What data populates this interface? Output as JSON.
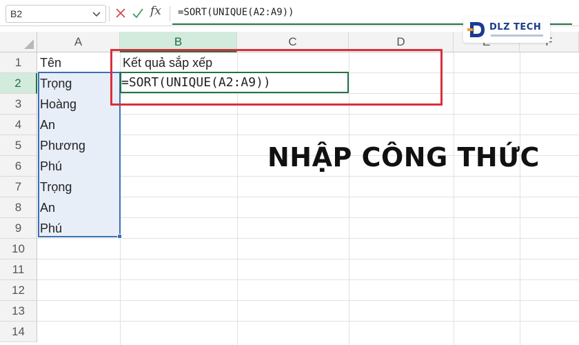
{
  "formula_bar": {
    "name_box": "B2",
    "formula": "=SORT(UNIQUE(A2:A9))",
    "fx_label": "fx"
  },
  "logo": {
    "text": "DLZ TECH"
  },
  "columns": [
    "A",
    "B",
    "C",
    "D",
    "E",
    "F"
  ],
  "rows": [
    "1",
    "2",
    "3",
    "4",
    "5",
    "6",
    "7",
    "8",
    "9",
    "10",
    "11",
    "12",
    "13",
    "14"
  ],
  "cells": {
    "A1": "Tên",
    "A2": "Trọng",
    "A3": "Hoàng",
    "A4": "An",
    "A5": "Phương",
    "A6": "Phú",
    "A7": "Trọng",
    "A8": "An",
    "A9": "Phú",
    "B1": "Kết quả sắp xếp",
    "B2": "=SORT(UNIQUE(A2:A9))"
  },
  "overlay": "NHẬP CÔNG THỨC",
  "colors": {
    "accent_green": "#217346",
    "range_blue": "#3b6fb6",
    "highlight_red": "#d7303b"
  }
}
